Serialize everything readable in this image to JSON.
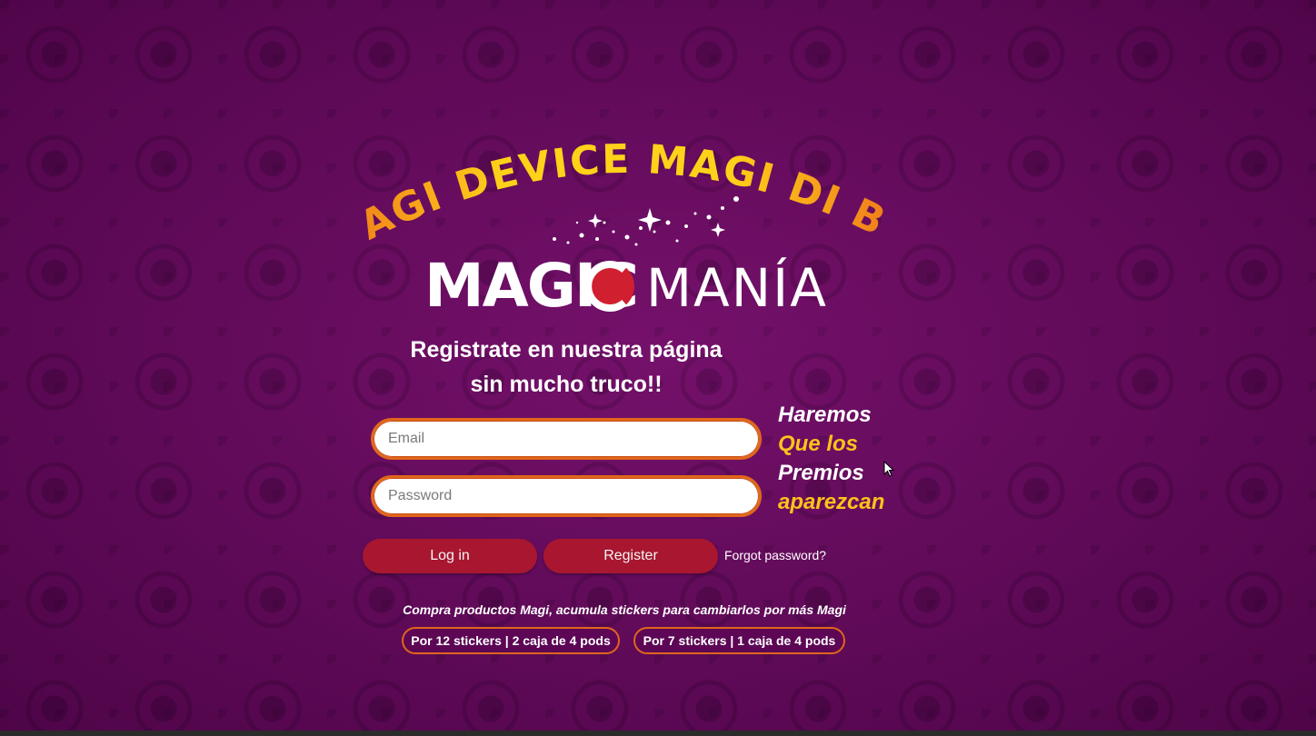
{
  "tagline": "¡MAGI DEVICE MAGI DI BU !",
  "logo": {
    "brand_bold": "MAGIC",
    "brand_light": "MANÍA"
  },
  "headline": {
    "line1": "Registrate en nuestra página",
    "line2": "sin mucho truco!!"
  },
  "form": {
    "email_placeholder": "Email",
    "password_placeholder": "Password",
    "login_label": "Log in",
    "register_label": "Register",
    "forgot_label": "Forgot password?"
  },
  "side_message": {
    "line1": "Haremos",
    "line2": "Que los",
    "line3": "Premios",
    "line4": "aparezcan"
  },
  "promo": {
    "text": "Compra productos Magi, acumula stickers para cambiarlos por más Magi",
    "offers": [
      "Por 12 stickers | 2 caja de 4 pods",
      "Por 7 stickers | 1 caja de 4 pods"
    ]
  },
  "colors": {
    "background": "#68095e",
    "accent_yellow": "#ffc21a",
    "accent_orange": "#e0661b",
    "button_red": "#a8172f",
    "logo_red": "#d01f2f"
  },
  "icons": [
    "sparkles-icon",
    "mouse-cursor-icon"
  ]
}
